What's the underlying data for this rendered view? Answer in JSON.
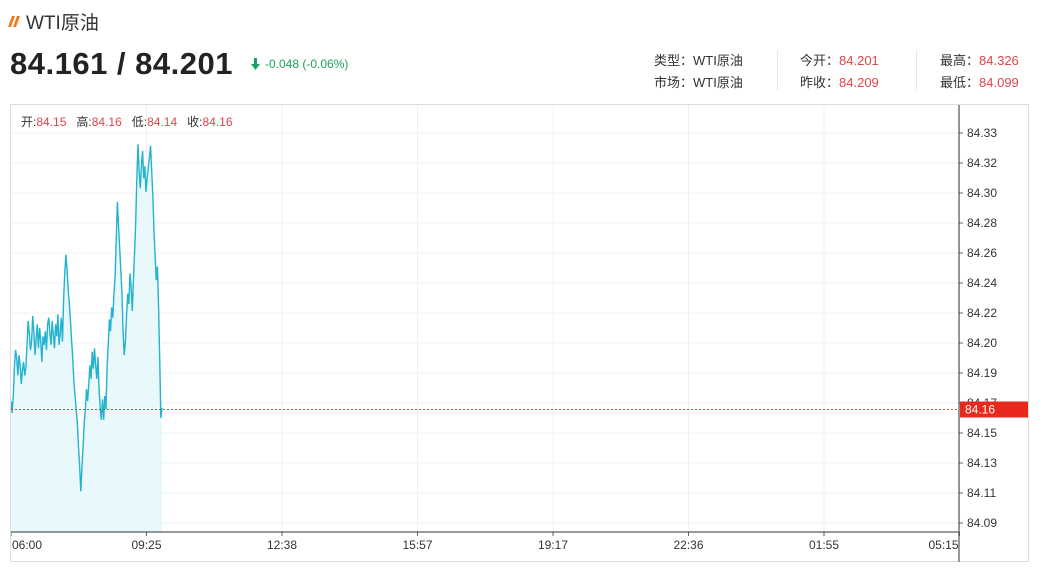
{
  "header": {
    "title": "WTI原油",
    "price_display": "84.161 / 84.201",
    "change": "-0.048 (-0.06%)",
    "change_direction": "down",
    "colors": {
      "up": "#e0454a",
      "down": "#1aa260",
      "accent": "#f07b1f",
      "line": "#21b3cf"
    }
  },
  "info": {
    "type_label": "类型：",
    "type_value": "WTI原油",
    "market_label": "市场：",
    "market_value": "WTI原油",
    "open_label": "今开：",
    "open_value": "84.201",
    "prev_close_label": "昨收：",
    "prev_close_value": "84.209",
    "high_label": "最高：",
    "high_value": "84.326",
    "low_label": "最低：",
    "low_value": "84.099"
  },
  "ohlc": {
    "open_label": "开:",
    "open_value": "84.15",
    "high_label": "高:",
    "high_value": "84.16",
    "low_label": "低:",
    "low_value": "84.14",
    "close_label": "收:",
    "close_value": "84.16"
  },
  "chart_data": {
    "type": "line",
    "title": "",
    "xlabel": "",
    "ylabel": "",
    "y_ticks": [
      "84.33",
      "84.32",
      "84.30",
      "84.28",
      "84.26",
      "84.24",
      "84.22",
      "84.20",
      "84.19",
      "84.17",
      "84.15",
      "84.13",
      "84.11",
      "84.09"
    ],
    "x_ticks": [
      "06:00",
      "09:25",
      "12:38",
      "15:57",
      "19:17",
      "22:36",
      "01:55",
      "05:15"
    ],
    "current_value": 84.16,
    "current_label": "84.16",
    "ylim": [
      84.088,
      84.339
    ],
    "fill": true,
    "grid": true,
    "series": [
      {
        "values": [
          84.165,
          84.158,
          84.168,
          84.185,
          84.195,
          84.19,
          84.18,
          84.192,
          84.186,
          84.175,
          84.183,
          84.188,
          84.18,
          84.185,
          84.198,
          84.212,
          84.205,
          84.195,
          84.2,
          84.215,
          84.205,
          84.192,
          84.202,
          84.21,
          84.196,
          84.208,
          84.2,
          84.188,
          84.203,
          84.198,
          84.206,
          84.195,
          84.21,
          84.214,
          84.205,
          84.198,
          84.212,
          84.204,
          84.196,
          84.21,
          84.203,
          84.216,
          84.198,
          84.205,
          84.214,
          84.2,
          84.225,
          84.24,
          84.251,
          84.242,
          84.23,
          84.222,
          84.212,
          84.2,
          84.19,
          84.176,
          84.168,
          84.16,
          84.152,
          84.138,
          84.127,
          84.112,
          84.126,
          84.138,
          84.152,
          84.16,
          84.172,
          84.165,
          84.175,
          84.186,
          84.178,
          84.194,
          84.184,
          84.196,
          84.186,
          84.178,
          84.191,
          84.172,
          84.161,
          84.154,
          84.166,
          84.154,
          84.168,
          84.16,
          84.185,
          84.198,
          84.213,
          84.206,
          84.22,
          84.214,
          84.228,
          84.238,
          84.26,
          84.282,
          84.268,
          84.255,
          84.242,
          84.228,
          84.205,
          84.192,
          84.2,
          84.215,
          84.228,
          84.222,
          84.24,
          84.232,
          84.218,
          84.236,
          84.252,
          84.27,
          84.296,
          84.316,
          84.3,
          84.29,
          84.303,
          84.312,
          84.296,
          84.303,
          84.288,
          84.296,
          84.302,
          84.308,
          84.315,
          84.3,
          84.286,
          84.265,
          84.25,
          84.236,
          84.244,
          84.22,
          84.19,
          84.155,
          84.161
        ]
      }
    ]
  }
}
